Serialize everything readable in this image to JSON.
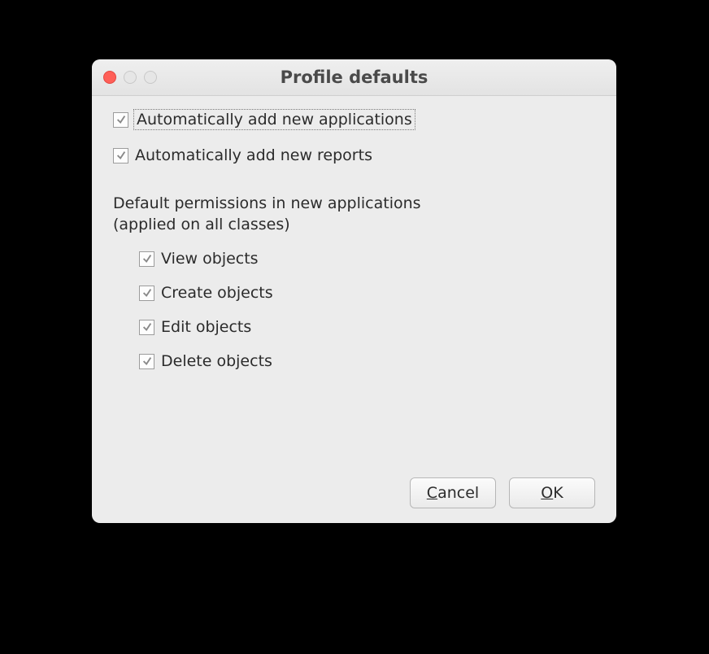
{
  "window": {
    "title": "Profile defaults"
  },
  "options": {
    "auto_add_applications": {
      "label": "Automatically add new applications",
      "checked": true,
      "focused": true
    },
    "auto_add_reports": {
      "label": "Automatically add new reports",
      "checked": true
    }
  },
  "permissions": {
    "heading_line1": "Default permissions in new applications",
    "heading_line2": "(applied on all classes)",
    "items": [
      {
        "label": "View objects",
        "checked": true
      },
      {
        "label": "Create objects",
        "checked": true
      },
      {
        "label": "Edit objects",
        "checked": true
      },
      {
        "label": "Delete objects",
        "checked": true
      }
    ]
  },
  "buttons": {
    "cancel": {
      "accel": "C",
      "rest": "ancel"
    },
    "ok": {
      "accel": "O",
      "rest": "K"
    }
  }
}
